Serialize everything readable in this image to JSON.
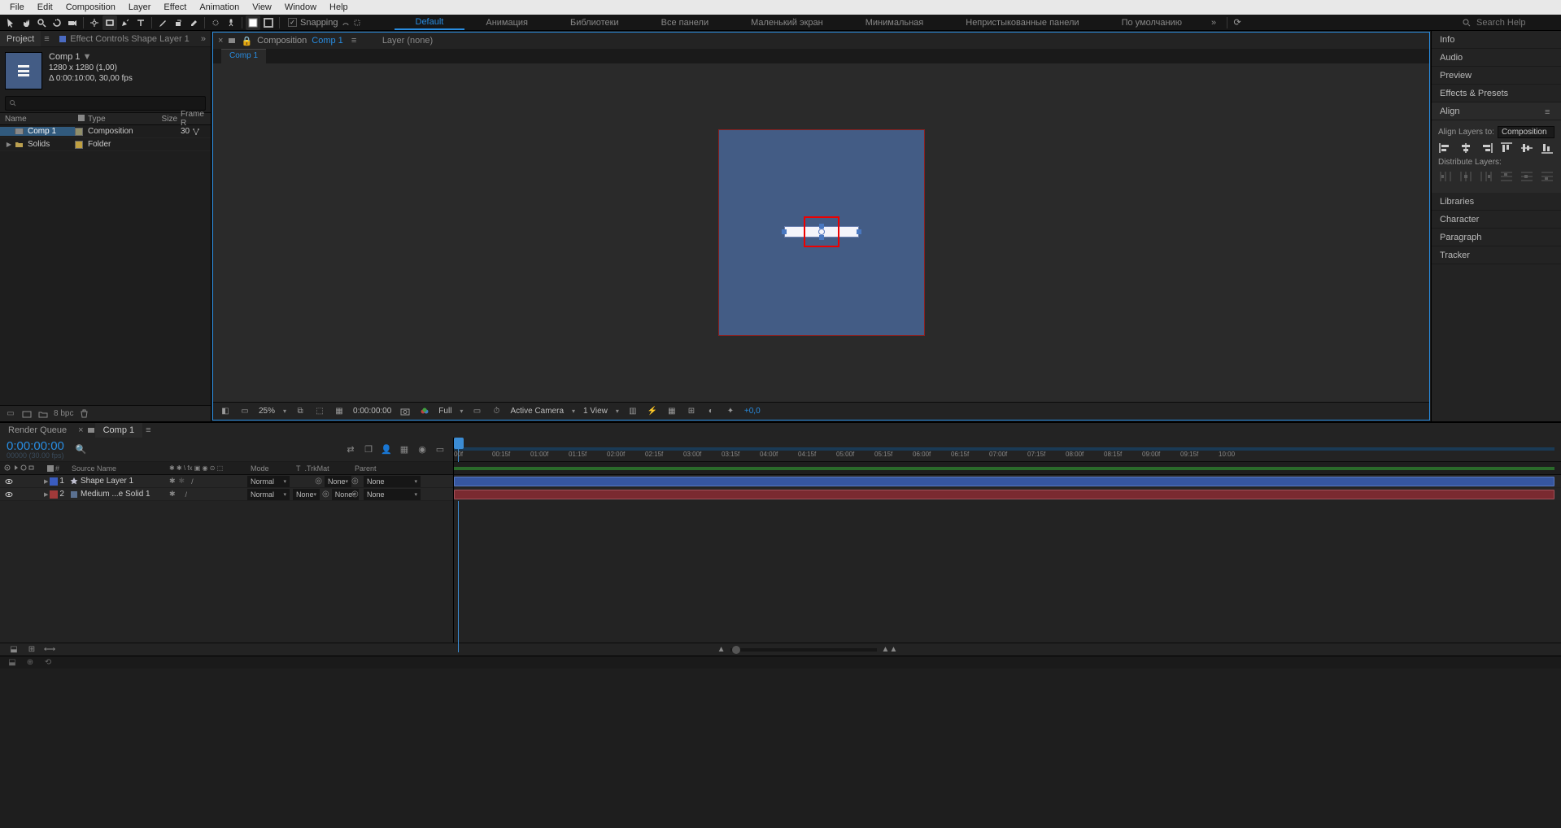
{
  "menu": [
    "File",
    "Edit",
    "Composition",
    "Layer",
    "Effect",
    "Animation",
    "View",
    "Window",
    "Help"
  ],
  "toolbar": {
    "snapping": "Snapping"
  },
  "workspaces": [
    "Default",
    "Анимация",
    "Библиотеки",
    "Все панели",
    "Маленький экран",
    "Минимальная",
    "Непристыкованные панели",
    "По умолчанию"
  ],
  "search_help_placeholder": "Search Help",
  "project": {
    "tabs": [
      "Project",
      "Effect Controls Shape Layer 1"
    ],
    "comp": {
      "name": "Comp 1",
      "dims": "1280 x 1280 (1,00)",
      "dur": "Δ 0:00:10:00, 30,00 fps"
    },
    "cols": {
      "name": "Name",
      "type": "Type",
      "size": "Size",
      "frame": "Frame R"
    },
    "rows": [
      {
        "name": "Comp 1",
        "type": "Composition",
        "fr": "30",
        "color": "#918f6a",
        "selected": true,
        "icon": "comp"
      },
      {
        "name": "Solids",
        "type": "Folder",
        "fr": "",
        "color": "#c0a040",
        "selected": false,
        "icon": "folder"
      }
    ],
    "foot_bpc": "8 bpc"
  },
  "viewer": {
    "label1": "Composition",
    "name": "Comp 1",
    "layer_none": "Layer  (none)",
    "subtab": "Comp 1",
    "foot": {
      "mag": "25%",
      "time": "0:00:00:00",
      "res": "Full",
      "camera": "Active Camera",
      "views": "1 View",
      "exp": "+0,0"
    }
  },
  "right": {
    "panels": [
      "Info",
      "Audio",
      "Preview",
      "Effects & Presets",
      "Align",
      "Libraries",
      "Character",
      "Paragraph",
      "Tracker"
    ],
    "align": {
      "layers_to": "Align Layers to:",
      "target": "Composition",
      "dist": "Distribute Layers:"
    }
  },
  "timeline": {
    "tabs": [
      "Render Queue",
      "Comp 1"
    ],
    "timecode": "0:00:00:00",
    "timecode_sub": "00000 (30.00 fps)",
    "cols": {
      "idx": "#",
      "src": "Source Name",
      "mode": "Mode",
      "t": "T",
      "trk": ".TrkMat",
      "par": "Parent"
    },
    "layers": [
      {
        "idx": "1",
        "name": "Shape Layer 1",
        "color": "#3a5cc0",
        "mode": "Normal",
        "trk": "",
        "none": "None",
        "par": "None",
        "barClass": "blue",
        "icon": "star"
      },
      {
        "idx": "2",
        "name": "Medium ...e Solid 1",
        "color": "#a03a3a",
        "mode": "Normal",
        "trk": "None",
        "none": "None",
        "par": "None",
        "barClass": "red",
        "icon": "solid"
      }
    ],
    "ruler": [
      "00f",
      "00:15f",
      "01:00f",
      "01:15f",
      "02:00f",
      "02:15f",
      "03:00f",
      "03:15f",
      "04:00f",
      "04:15f",
      "05:00f",
      "05:15f",
      "06:00f",
      "06:15f",
      "07:00f",
      "07:15f",
      "08:00f",
      "08:15f",
      "09:00f",
      "09:15f",
      "10:00"
    ]
  }
}
